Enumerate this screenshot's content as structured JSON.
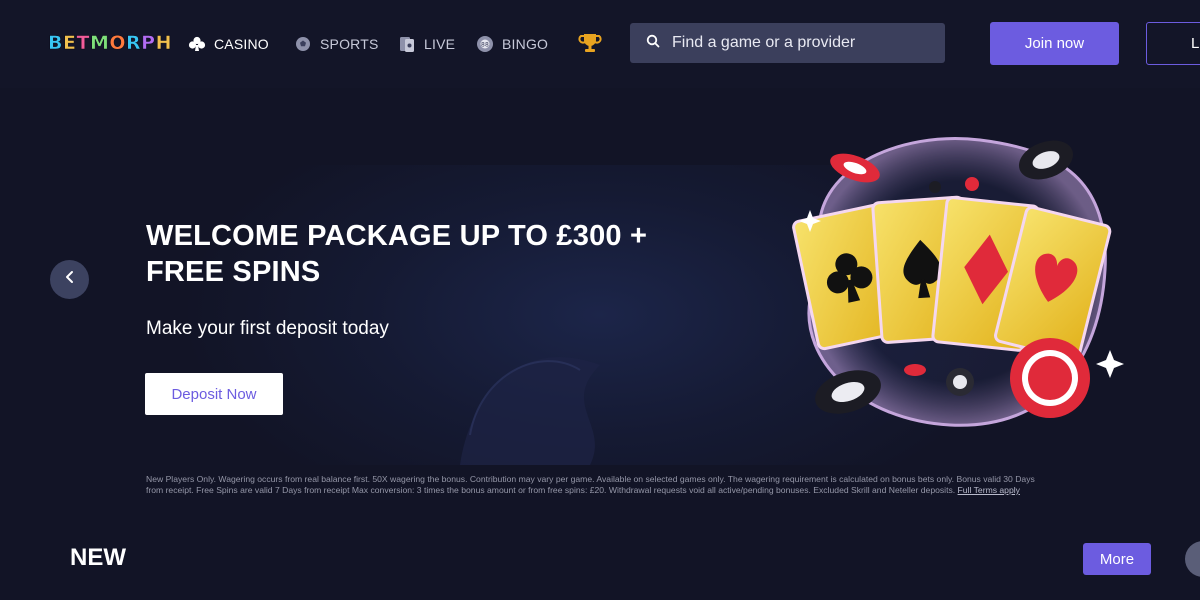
{
  "header": {
    "logo_letters": [
      {
        "char": "B",
        "color": "#38c6f4"
      },
      {
        "char": "E",
        "color": "#f2c14e"
      },
      {
        "char": "T",
        "color": "#f25c9a"
      },
      {
        "char": "M",
        "color": "#7ee07a"
      },
      {
        "char": "O",
        "color": "#ff7a3d"
      },
      {
        "char": "R",
        "color": "#38c6f4"
      },
      {
        "char": "P",
        "color": "#b26cf2"
      },
      {
        "char": "H",
        "color": "#f2c14e"
      }
    ],
    "nav": [
      {
        "label": "CASINO",
        "icon": "clubs-icon",
        "active": true
      },
      {
        "label": "SPORTS",
        "icon": "soccer-ball-icon",
        "active": false
      },
      {
        "label": "LIVE",
        "icon": "live-cards-icon",
        "active": false
      },
      {
        "label": "BINGO",
        "icon": "bingo-ball-icon",
        "active": false
      }
    ],
    "promotions_icon": "trophy-icon",
    "search": {
      "placeholder": "Find a game or a provider",
      "icon": "search-icon"
    },
    "join_label": "Join now",
    "login_label": "Lo"
  },
  "hero": {
    "title_line1": "WELCOME PACKAGE UP TO £300 +",
    "title_line2": "FREE SPINS",
    "subtitle": "Make your first deposit today",
    "cta_label": "Deposit Now",
    "prev_icon": "chevron-left-icon",
    "art": "playing-cards-and-chips-illustration",
    "terms_line1": "New Players Only. Wagering occurs from real balance first. 50X wagering the bonus. Contribution may vary per game. Available on selected games only. The wagering requirement is calculated on bonus bets only. Bonus valid 30 Days",
    "terms_line2": "from receipt. Free Spins are valid 7 Days from receipt Max conversion: 3 times the bonus amount or from free spins: £20. Withdrawal requests void all active/pending bonuses. Excluded Skrill and Neteller deposits.",
    "terms_link": "Full Terms apply"
  },
  "section": {
    "heading": "NEW",
    "more_label": "More"
  },
  "colors": {
    "accent": "#6c5ce0",
    "background": "#121426",
    "search_bg": "#3b3f5c"
  }
}
